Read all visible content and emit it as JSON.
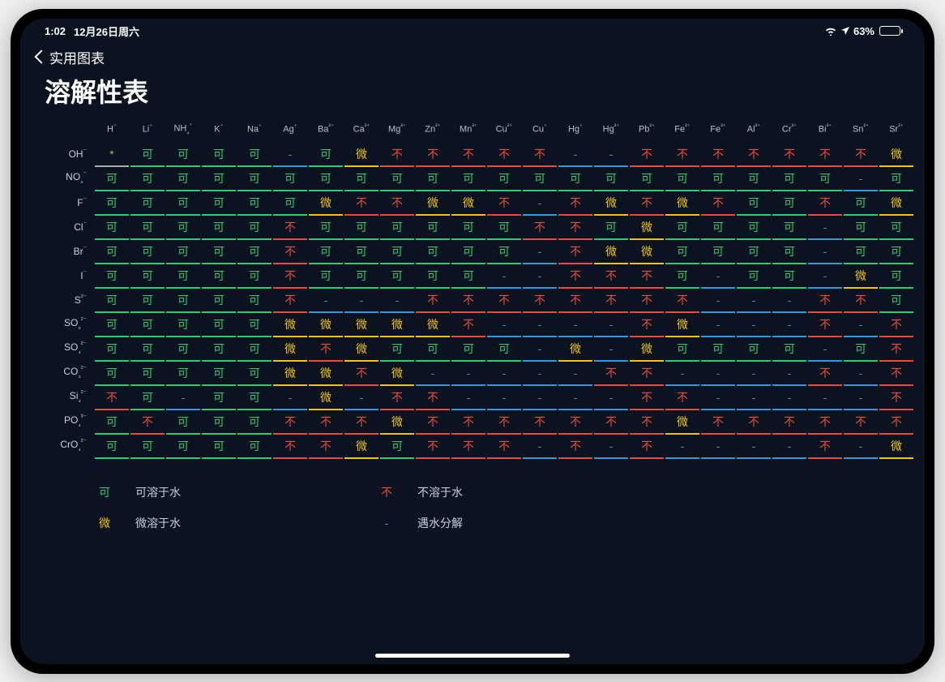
{
  "status": {
    "time": "1:02",
    "date": "12月26日周六",
    "battery_pct": "63%"
  },
  "nav": {
    "back_label": "实用图表"
  },
  "page": {
    "title": "溶解性表"
  },
  "legend": {
    "soluble": {
      "char": "可",
      "label": "可溶于水"
    },
    "slight": {
      "char": "微",
      "label": "微溶于水"
    },
    "insoluble": {
      "char": "不",
      "label": "不溶于水"
    },
    "decompose": {
      "char": "-",
      "label": "遇水分解"
    }
  },
  "chart_data": {
    "type": "table",
    "title": "溶解性表",
    "state_map": {
      "sol": {
        "display": "可",
        "meaning": "可溶于水"
      },
      "ins": {
        "display": "不",
        "meaning": "不溶于水"
      },
      "sli": {
        "display": "微",
        "meaning": "微溶于水"
      },
      "dec": {
        "display": "-",
        "meaning": "遇水分解"
      },
      "star": {
        "display": "*",
        "meaning": ""
      }
    },
    "cations": [
      "H⁺",
      "Li⁺",
      "NH₄⁺",
      "K⁺",
      "Na⁺",
      "Ag⁺",
      "Ba²⁺",
      "Ca²⁺",
      "Mg²⁺",
      "Zn²⁺",
      "Mn²⁺",
      "Cu²⁺",
      "Cu⁺",
      "Hg⁺",
      "Hg²⁺",
      "Pb²⁺",
      "Fe²⁺",
      "Fe³⁺",
      "Al³⁺",
      "Cr³⁺",
      "Bi³⁺",
      "Sn²⁺",
      "Sr²⁺"
    ],
    "anions": [
      "OH⁻",
      "NO₃⁻",
      "F⁻",
      "Cl⁻",
      "Br⁻",
      "I⁻",
      "S²⁻",
      "SO₃²⁻",
      "SO₄²⁻",
      "CO₃²⁻",
      "Si₃²⁻",
      "PO₄³⁻",
      "CrO₄²⁻"
    ],
    "grid": [
      [
        "star",
        "sol",
        "sol",
        "sol",
        "sol",
        "dec",
        "sol",
        "sli",
        "ins",
        "ins",
        "ins",
        "ins",
        "ins",
        "dec",
        "dec",
        "ins",
        "ins",
        "ins",
        "ins",
        "ins",
        "ins",
        "ins",
        "sli"
      ],
      [
        "sol",
        "sol",
        "sol",
        "sol",
        "sol",
        "sol",
        "sol",
        "sol",
        "sol",
        "sol",
        "sol",
        "sol",
        "sol",
        "sol",
        "sol",
        "sol",
        "sol",
        "sol",
        "sol",
        "sol",
        "sol",
        "dec",
        "sol"
      ],
      [
        "sol",
        "sol",
        "sol",
        "sol",
        "sol",
        "sol",
        "sli",
        "ins",
        "ins",
        "sli",
        "sli",
        "ins",
        "dec",
        "ins",
        "sli",
        "ins",
        "sli",
        "ins",
        "sol",
        "sol",
        "ins",
        "sol",
        "sli"
      ],
      [
        "sol",
        "sol",
        "sol",
        "sol",
        "sol",
        "ins",
        "sol",
        "sol",
        "sol",
        "sol",
        "sol",
        "sol",
        "ins",
        "ins",
        "sol",
        "sli",
        "sol",
        "sol",
        "sol",
        "sol",
        "dec",
        "sol",
        "sol"
      ],
      [
        "sol",
        "sol",
        "sol",
        "sol",
        "sol",
        "ins",
        "sol",
        "sol",
        "sol",
        "sol",
        "sol",
        "sol",
        "dec",
        "ins",
        "sli",
        "sli",
        "sol",
        "sol",
        "sol",
        "sol",
        "dec",
        "sol",
        "sol"
      ],
      [
        "sol",
        "sol",
        "sol",
        "sol",
        "sol",
        "ins",
        "sol",
        "sol",
        "sol",
        "sol",
        "sol",
        "dec",
        "dec",
        "ins",
        "ins",
        "ins",
        "sol",
        "dec",
        "sol",
        "sol",
        "dec",
        "sli",
        "sol"
      ],
      [
        "sol",
        "sol",
        "sol",
        "sol",
        "sol",
        "ins",
        "dec",
        "dec",
        "dec",
        "ins",
        "ins",
        "ins",
        "ins",
        "ins",
        "ins",
        "ins",
        "ins",
        "dec",
        "dec",
        "dec",
        "ins",
        "ins",
        "sol"
      ],
      [
        "sol",
        "sol",
        "sol",
        "sol",
        "sol",
        "sli",
        "sli",
        "sli",
        "sli",
        "sli",
        "ins",
        "dec",
        "dec",
        "dec",
        "dec",
        "ins",
        "sli",
        "dec",
        "dec",
        "dec",
        "ins",
        "dec",
        "ins"
      ],
      [
        "sol",
        "sol",
        "sol",
        "sol",
        "sol",
        "sli",
        "ins",
        "sli",
        "sol",
        "sol",
        "sol",
        "sol",
        "dec",
        "sli",
        "dec",
        "sli",
        "sol",
        "sol",
        "sol",
        "sol",
        "dec",
        "sol",
        "ins"
      ],
      [
        "sol",
        "sol",
        "sol",
        "sol",
        "sol",
        "sli",
        "sli",
        "ins",
        "sli",
        "dec",
        "dec",
        "dec",
        "dec",
        "dec",
        "ins",
        "ins",
        "dec",
        "dec",
        "dec",
        "dec",
        "ins",
        "dec",
        "ins"
      ],
      [
        "ins",
        "sol",
        "dec",
        "sol",
        "sol",
        "dec",
        "sli",
        "dec",
        "ins",
        "ins",
        "dec",
        "dec",
        "dec",
        "dec",
        "dec",
        "ins",
        "ins",
        "dec",
        "dec",
        "dec",
        "dec",
        "dec",
        "ins"
      ],
      [
        "sol",
        "ins",
        "sol",
        "sol",
        "sol",
        "ins",
        "ins",
        "ins",
        "sli",
        "ins",
        "ins",
        "ins",
        "ins",
        "ins",
        "ins",
        "ins",
        "sli",
        "ins",
        "ins",
        "ins",
        "ins",
        "ins",
        "ins"
      ],
      [
        "sol",
        "sol",
        "sol",
        "sol",
        "sol",
        "ins",
        "ins",
        "sli",
        "sol",
        "ins",
        "ins",
        "ins",
        "dec",
        "ins",
        "dec",
        "ins",
        "dec",
        "dec",
        "dec",
        "dec",
        "ins",
        "dec",
        "sli"
      ]
    ]
  }
}
